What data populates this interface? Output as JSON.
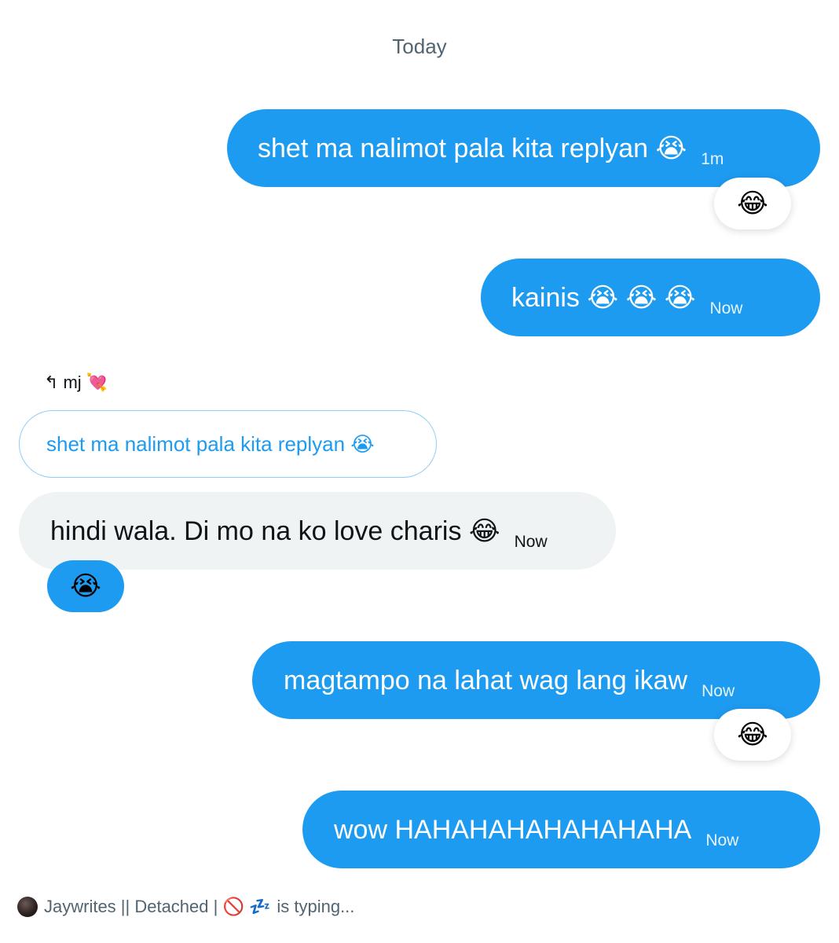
{
  "date_separator": "Today",
  "messages": [
    {
      "text": "shet ma nalimot pala kita replyan 😭",
      "time": "1m",
      "reaction": "😂"
    },
    {
      "text": "kainis 😭 😭 😭",
      "time": "Now"
    },
    {
      "reply_to_name": "mj 💘",
      "reply_icon": "reply-arrow-icon",
      "quoted_text": "shet ma nalimot pala kita replyan 😭",
      "text": "hindi wala. Di mo na ko love charis 😂",
      "time": "Now",
      "reaction": "😭"
    },
    {
      "text": "magtampo na lahat wag lang ikaw",
      "time": "Now",
      "reaction": "😂"
    },
    {
      "text": "wow HAHAHAHAHAHAHAHA",
      "time": "Now"
    }
  ],
  "typing": {
    "name": "Jaywrites || Detached | 🚫 💤",
    "status": "is typing..."
  },
  "colors": {
    "outgoing_bubble": "#1d9bf0",
    "incoming_bubble": "#eff3f4",
    "muted_text": "#536471"
  }
}
